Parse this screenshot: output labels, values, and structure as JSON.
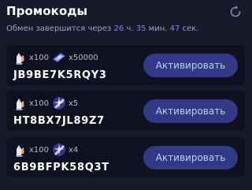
{
  "header": {
    "title": "Промокоды",
    "timer": {
      "prefix": "Обмен завершится через",
      "hours": "26",
      "hours_unit": "ч.",
      "minutes": "35",
      "minutes_unit": "мин.",
      "seconds": "47",
      "seconds_unit": "сек."
    }
  },
  "promocodes": [
    {
      "rewards": [
        {
          "icon": "crystal-fist-icon",
          "qty": "x100"
        },
        {
          "icon": "gem-ticket-icon",
          "qty": "x50000"
        }
      ],
      "code": "JB9BE7K5RQY3",
      "button": "Активировать"
    },
    {
      "rewards": [
        {
          "icon": "crystal-fist-icon",
          "qty": "x100"
        },
        {
          "icon": "magic-scroll-icon",
          "qty": "x5"
        }
      ],
      "code": "HT8BX7JL89Z7",
      "button": "Активировать"
    },
    {
      "rewards": [
        {
          "icon": "crystal-fist-icon",
          "qty": "x100"
        },
        {
          "icon": "magic-scroll-icon",
          "qty": "x4"
        }
      ],
      "code": "6B9BFPK58Q3T",
      "button": "Активировать"
    }
  ],
  "colors": {
    "background": "#171a2b",
    "card": "#0f1120",
    "button": "#303a85",
    "timer_accent": "#7c83e6"
  }
}
